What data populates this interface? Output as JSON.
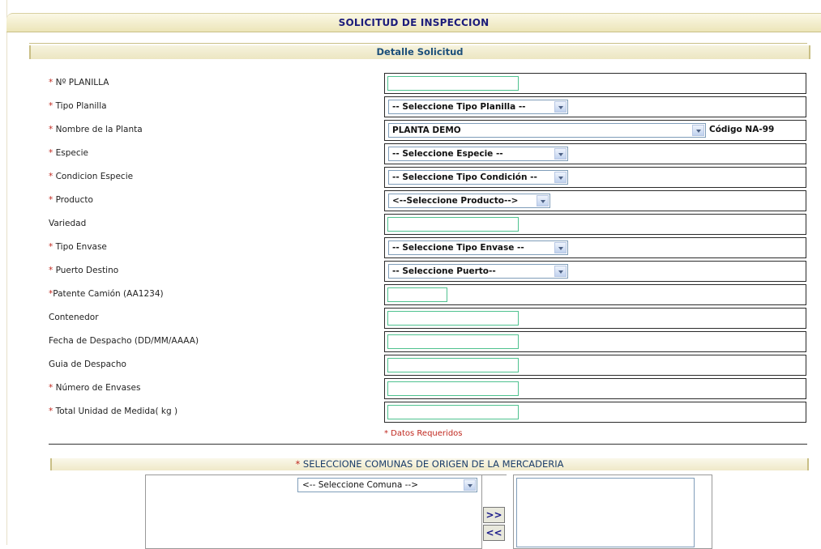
{
  "header": {
    "title": "SOLICITUD DE INSPECCION"
  },
  "section": {
    "title": "Detalle Solicitud"
  },
  "fields": [
    {
      "required": true,
      "label": "Nº PLANILLA"
    },
    {
      "required": true,
      "label": "Tipo Planilla",
      "select": "-- Seleccione Tipo Planilla --"
    },
    {
      "required": true,
      "label": "Nombre de la Planta",
      "select": "PLANTA DEMO",
      "code": "Código NA-99"
    },
    {
      "required": true,
      "label": "Especie",
      "select": "-- Seleccione Especie --"
    },
    {
      "required": true,
      "label": "Condicion Especie",
      "select": "-- Seleccione Tipo Condición --"
    },
    {
      "required": true,
      "label": "Producto",
      "select": "<--Seleccione Producto-->"
    },
    {
      "required": false,
      "label": "Variedad"
    },
    {
      "required": true,
      "label": "Tipo Envase",
      "select": "-- Seleccione Tipo Envase --"
    },
    {
      "required": true,
      "label": "Puerto Destino",
      "select": "-- Seleccione Puerto--"
    },
    {
      "required": true,
      "label": "Patente Camión (AA1234)"
    },
    {
      "required": false,
      "label": "Contenedor"
    },
    {
      "required": false,
      "label": "Fecha de Despacho (DD/MM/AAAA)"
    },
    {
      "required": false,
      "label": "Guia de Despacho"
    },
    {
      "required": true,
      "label": "Número de Envases"
    },
    {
      "required": true,
      "label": "Total Unidad de Medida( kg )"
    }
  ],
  "required_note": "* Datos Requeridos",
  "comunas": {
    "title": "* SELECCIONE COMUNAS DE ORIGEN DE LA MERCADERIA",
    "select": "<-- Seleccione Comuna -->",
    "add_label": ">>",
    "remove_label": "<<"
  },
  "colors": {
    "required": "#c0281f",
    "header_bg": "#ece5b8",
    "input_border": "#4fc28f"
  }
}
